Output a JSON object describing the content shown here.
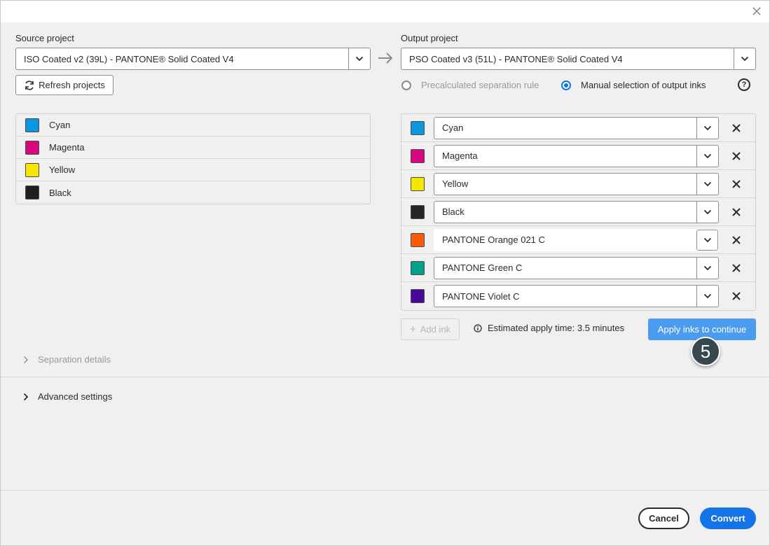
{
  "dialog": {
    "close_icon": "close-icon"
  },
  "source": {
    "label": "Source project",
    "selected": "ISO Coated v2 (39L) - PANTONE® Solid Coated V4",
    "refresh_label": "Refresh projects",
    "inks": [
      {
        "name": "Cyan",
        "color": "#0b96de"
      },
      {
        "name": "Magenta",
        "color": "#d7087e"
      },
      {
        "name": "Yellow",
        "color": "#f7e600"
      },
      {
        "name": "Black",
        "color": "#1f1f1f"
      }
    ]
  },
  "output": {
    "label": "Output project",
    "selected": "PSO Coated v3 (51L) - PANTONE® Solid Coated V4",
    "mode_options": [
      {
        "label": "Precalculated separation rule",
        "selected": false,
        "disabled": true
      },
      {
        "label": "Manual selection of output inks",
        "selected": true,
        "disabled": false
      }
    ],
    "inks": [
      {
        "name": "Cyan",
        "color": "#0b96de"
      },
      {
        "name": "Magenta",
        "color": "#d7087e"
      },
      {
        "name": "Yellow",
        "color": "#f7e600"
      },
      {
        "name": "Black",
        "color": "#262626"
      },
      {
        "name": "PANTONE Orange 021 C",
        "color": "#fa5a0a"
      },
      {
        "name": "PANTONE Green C",
        "color": "#00a287"
      },
      {
        "name": "PANTONE Violet C",
        "color": "#4a079b"
      }
    ],
    "add_ink_label": "Add ink",
    "estimate_text": "Estimated apply time: 3.5 minutes",
    "apply_label": "Apply inks to continue"
  },
  "step_badge": "5",
  "sections": {
    "separation_details": "Separation details",
    "advanced_settings": "Advanced settings"
  },
  "footer": {
    "cancel_label": "Cancel",
    "convert_label": "Convert"
  },
  "colors": {
    "accent": "#1473e6",
    "apply_bg": "#4b9cf0",
    "badge": "#37474f"
  }
}
